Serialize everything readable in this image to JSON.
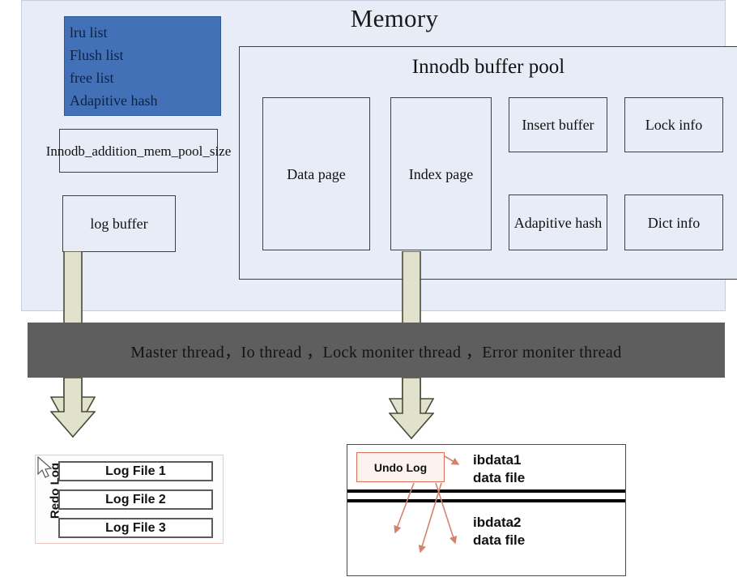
{
  "diagram": {
    "title": "Memory",
    "memory": {
      "lists_box": {
        "lines": [
          "lru list",
          "Flush list",
          "free list",
          "Adapitive hash"
        ],
        "fill_color": "#4271b7"
      },
      "addition_mem_pool": "Innodb_addition_mem_pool_size",
      "log_buffer": "log buffer",
      "buffer_pool": {
        "title": "Innodb buffer pool",
        "cells": [
          {
            "label": "Data page"
          },
          {
            "label": "Index page"
          },
          {
            "label": "Insert buffer"
          },
          {
            "label": "Lock info"
          },
          {
            "label": "Adapitive hash"
          },
          {
            "label": "Dict info"
          }
        ]
      }
    },
    "thread_bar": {
      "text": "Master thread，Io thread ，Lock moniter thread ，Error moniter thread",
      "background_color": "#5e5e5e"
    },
    "redo_log": {
      "label": "Redo Log",
      "files": [
        "Log File 1",
        "Log File 2",
        "Log File 3"
      ],
      "border_color": "#eec7bb"
    },
    "ibdata": {
      "undo_log": "Undo Log",
      "file1": "ibdata1\ndata file",
      "file2": "ibdata2\ndata file",
      "arrow_color": "#d4846d"
    },
    "arrows": {
      "left_name": "log-buffer-to-redo-log-arrow",
      "right_name": "buffer-pool-to-ibdata-arrow",
      "fill_color": "#e0e2cc",
      "stroke_color": "#4a4a3a"
    }
  }
}
